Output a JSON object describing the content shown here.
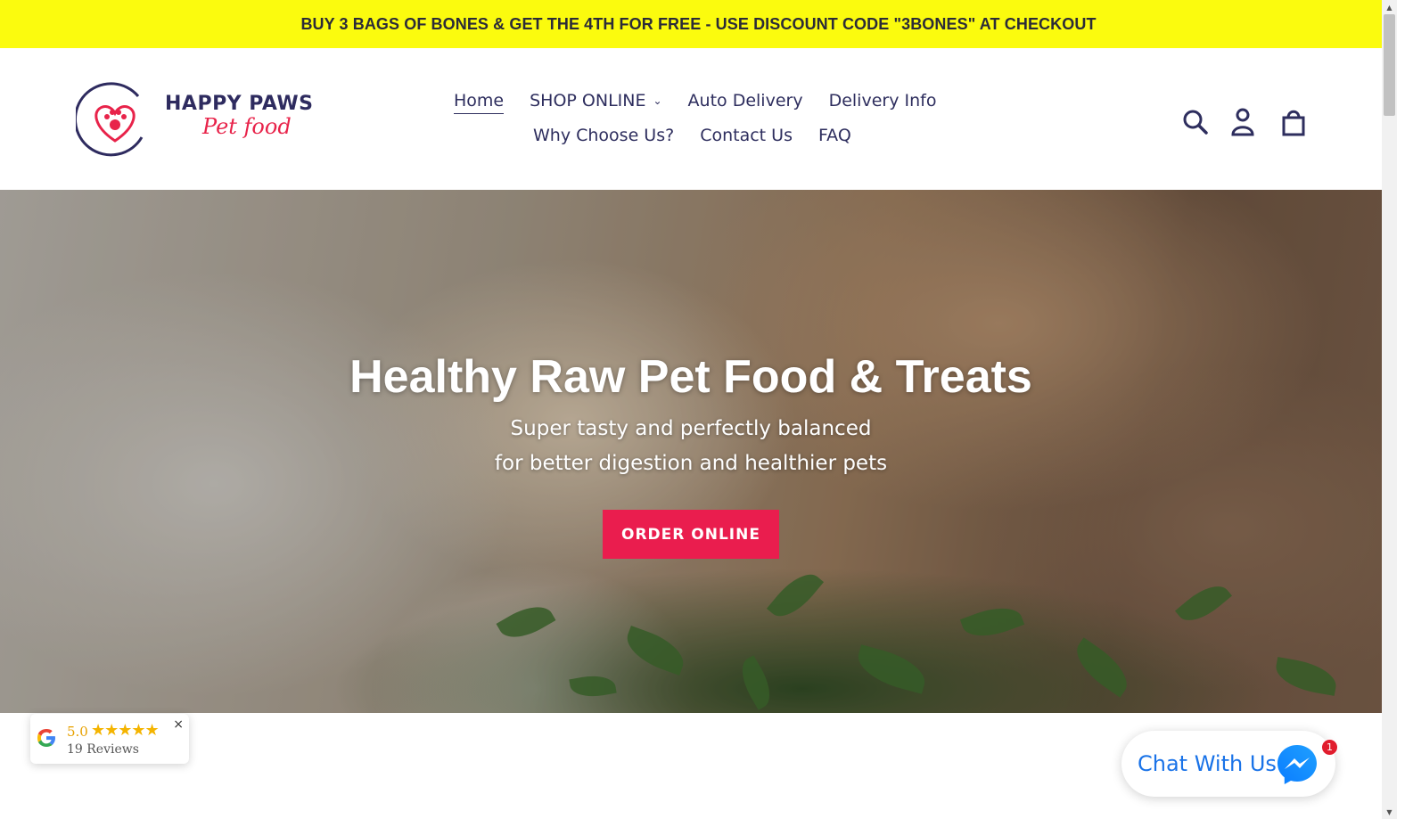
{
  "announcement": {
    "text": "BUY 3 BAGS OF BONES & GET THE 4TH FOR FREE - USE DISCOUNT CODE \"3BONES\" AT CHECKOUT"
  },
  "brand": {
    "name_line1": "HAPPY PAWS",
    "name_line2": "Pet food",
    "accent": "#e8234a",
    "primary": "#2e2b5f"
  },
  "nav": {
    "items": [
      {
        "label": "Home",
        "active": true
      },
      {
        "label": "SHOP ONLINE",
        "has_dropdown": true
      },
      {
        "label": "Auto Delivery"
      },
      {
        "label": "Delivery Info"
      },
      {
        "label": "Why Choose Us?"
      },
      {
        "label": "Contact Us"
      },
      {
        "label": "FAQ"
      }
    ]
  },
  "header_icons": [
    "search-icon",
    "account-icon",
    "cart-icon"
  ],
  "hero": {
    "title": "Healthy Raw Pet Food & Treats",
    "subtitle_line1": "Super tasty and perfectly balanced",
    "subtitle_line2": "for better digestion and healthier pets",
    "button_label": "ORDER ONLINE",
    "button_color": "#ea1d4e"
  },
  "google_badge": {
    "score": "5.0",
    "stars": 5,
    "reviews": "19 Reviews",
    "close": "×"
  },
  "chat": {
    "label": "Chat With Us",
    "badge_count": "1",
    "color": "#1a73e8"
  }
}
